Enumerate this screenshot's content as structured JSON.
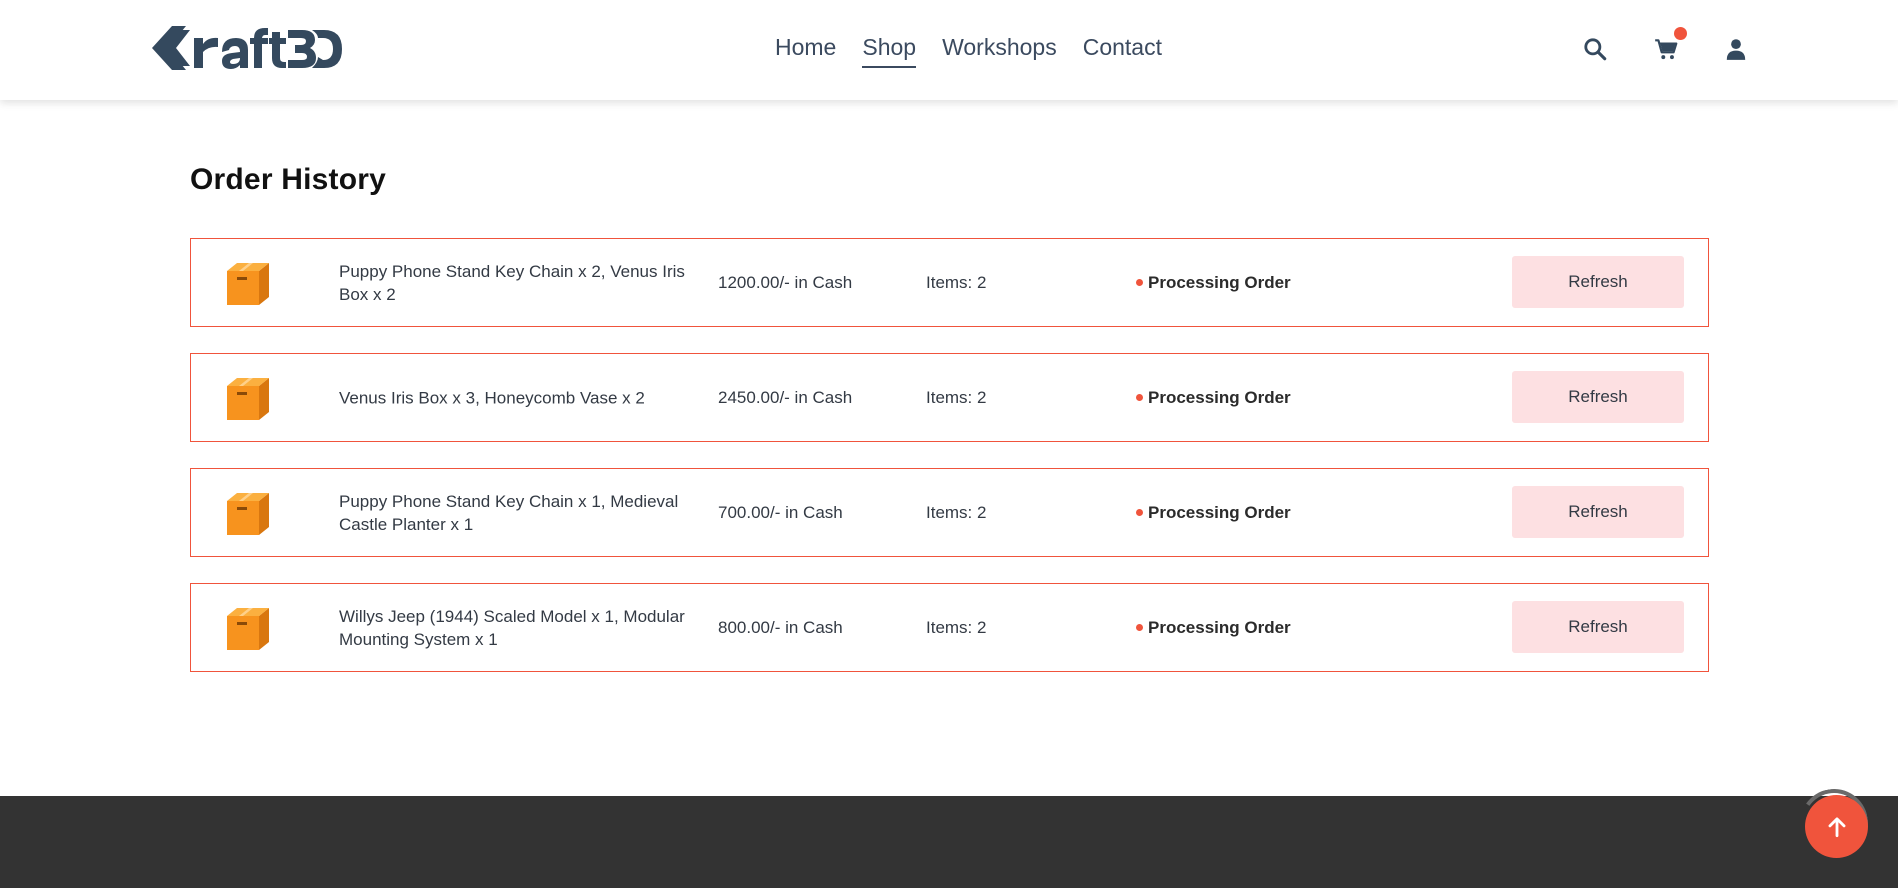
{
  "header": {
    "logo_text": "Kraft3D",
    "nav": [
      {
        "label": "Home",
        "active": false
      },
      {
        "label": "Shop",
        "active": true
      },
      {
        "label": "Workshops",
        "active": false
      },
      {
        "label": "Contact",
        "active": false
      }
    ],
    "icons": [
      "search-icon",
      "cart-icon",
      "user-icon"
    ],
    "cart_has_badge": true
  },
  "main": {
    "title": "Order History",
    "orders": [
      {
        "items": "Puppy Phone Stand Key Chain x 2, Venus Iris Box x 2",
        "total": "1200.00/- in Cash",
        "count": "Items: 2",
        "status": "Processing Order",
        "action": "Refresh"
      },
      {
        "items": "Venus Iris Box x 3, Honeycomb Vase x 2",
        "total": "2450.00/- in Cash",
        "count": "Items: 2",
        "status": "Processing Order",
        "action": "Refresh"
      },
      {
        "items": "Puppy Phone Stand Key Chain x 1, Medieval Castle Planter x 1",
        "total": "700.00/- in Cash",
        "count": "Items: 2",
        "status": "Processing Order",
        "action": "Refresh"
      },
      {
        "items": "Willys Jeep (1944) Scaled Model x 1, Modular Mounting System x 1",
        "total": "800.00/- in Cash",
        "count": "Items: 2",
        "status": "Processing Order",
        "action": "Refresh"
      }
    ]
  },
  "colors": {
    "accent": "#f0543c",
    "nav_text": "#3b4a5f",
    "button_bg": "#fde0e2",
    "footer_bg": "#333333",
    "box_orange": "#f7931e"
  }
}
